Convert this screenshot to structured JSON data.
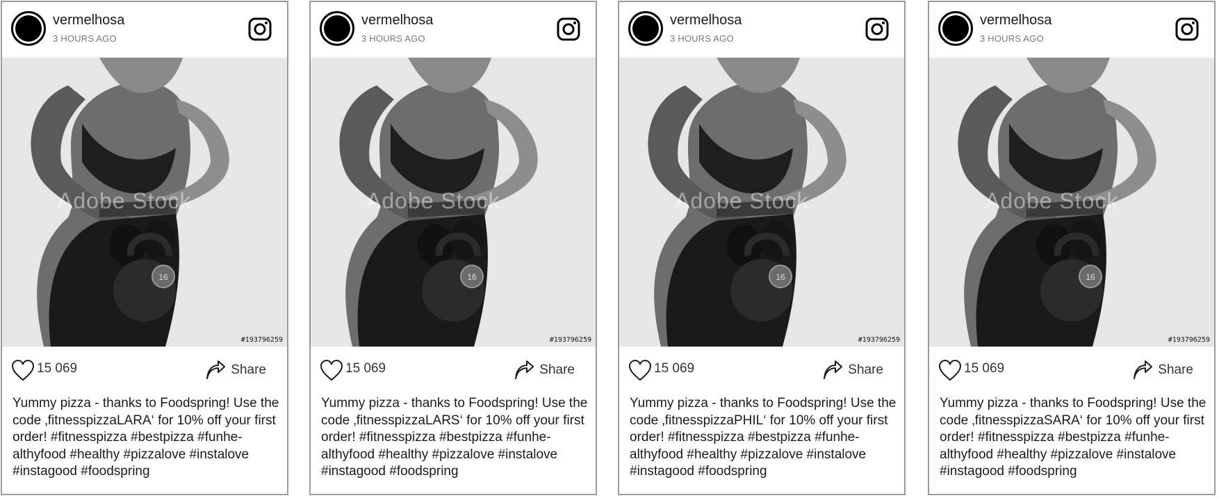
{
  "posts": [
    {
      "username": "vermelhosa",
      "time": "3 HOURS AGO",
      "likes": "15 069",
      "share_label": "Share",
      "watermark": "Adobe Stock",
      "stock_id": "#193796259",
      "caption": "Yummy pizza - thanks to Foodspring! Use the code ‚fitnesspizzaLARA‘ for 10% off your first order! #fitnesspizza #bestpizza #funhe-althyfood #healthy #pizzalove #instalove #instagood #foodspring"
    },
    {
      "username": "vermelhosa",
      "time": "3 HOURS AGO",
      "likes": "15 069",
      "share_label": "Share",
      "watermark": "Adobe Stock",
      "stock_id": "#193796259",
      "caption": "Yummy pizza - thanks to Foodspring! Use the code ‚fitnesspizzaLARS‘ for 10% off your first order! #fitnesspizza #bestpizza #funhe-althyfood #healthy #pizzalove #instalove #instagood #foodspring"
    },
    {
      "username": "vermelhosa",
      "time": "3 HOURS AGO",
      "likes": "15 069",
      "share_label": "Share",
      "watermark": "Adobe Stock",
      "stock_id": "#193796259",
      "caption": "Yummy pizza - thanks to Foodspring! Use the code ‚fitnesspizzaPHIL‘ for 10% off your first order! #fitnesspizza #bestpizza #funhe-althyfood #healthy #pizzalove #instalove #instagood #foodspring"
    },
    {
      "username": "vermelhosa",
      "time": "3 HOURS AGO",
      "likes": "15 069",
      "share_label": "Share",
      "watermark": "Adobe Stock",
      "stock_id": "#193796259",
      "caption": "Yummy pizza - thanks to Foodspring! Use the code ‚fitnesspizzaSARA‘ for 10% off your first order! #fitnesspizza #bestpizza #funhe-althyfood #healthy #pizzalove #instalove #instagood #foodspring"
    }
  ],
  "photo_text": {
    "kettlebell_weight": "16"
  },
  "icons": {
    "brand": "instagram-icon",
    "like": "heart-icon",
    "share": "share-arrow-icon"
  },
  "colors": {
    "card_border": "#9a9a9a",
    "photo_bg": "#e6e6e6",
    "text": "#1a1a1a",
    "muted": "#777777"
  }
}
